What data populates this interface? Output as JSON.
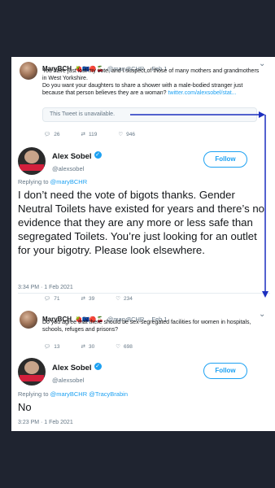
{
  "tweet1": {
    "name": "MaryBCH",
    "emoji": "🍓🇪🇺🔴🍒",
    "handle": "@maryBCHR",
    "time": "· Feb 1",
    "text": "You have just lost my vote, and I suspect,of those of many mothers and grandmothers in West Yorkshire.",
    "text2": "Do you want your daughters to share a shower with a male-bodied stranger just because that person believes they are a woman?",
    "link": "twitter.com/alexsobel/stat...",
    "unavailable": "This Tweet is unavailable.",
    "replies": "26",
    "retweets": "119",
    "likes": "946"
  },
  "tweet2": {
    "name": "Alex Sobel",
    "handle": "@alexsobel",
    "follow": "Follow",
    "replying_prefix": "Replying to ",
    "replying_to": "@maryBCHR",
    "text": "I don’t need the vote of bigots thanks. Gender Neutral Toilets have existed for years and there’s no evidence that they are any more or less safe than segregated Toilets. You’re just looking for an outlet for your bigotry. Please look elsewhere.",
    "time": "3:34 PM · 1 Feb 2021",
    "replies": "71",
    "retweets": "39",
    "likes": "234"
  },
  "tweet3": {
    "name": "MaryBCH",
    "emoji": "🍓🇪🇺🔴🍒",
    "handle": "@maryBCHR",
    "time": "· Feb 1",
    "text": "Do you agree that there should be sex-segregated facilities for women in hospitals, schools, refuges and prisons?",
    "replies": "13",
    "retweets": "30",
    "likes": "698"
  },
  "tweet4": {
    "name": "Alex Sobel",
    "handle": "@alexsobel",
    "follow": "Follow",
    "replying_prefix": "Replying to ",
    "replying_to": "@maryBCHR @TracyBrabin",
    "text": "No",
    "time": "3:23 PM · 1 Feb 2021"
  },
  "colors": {
    "background": "#1f2430",
    "accent": "#1da1f2",
    "annotation_arrow": "#1c2fbf"
  }
}
